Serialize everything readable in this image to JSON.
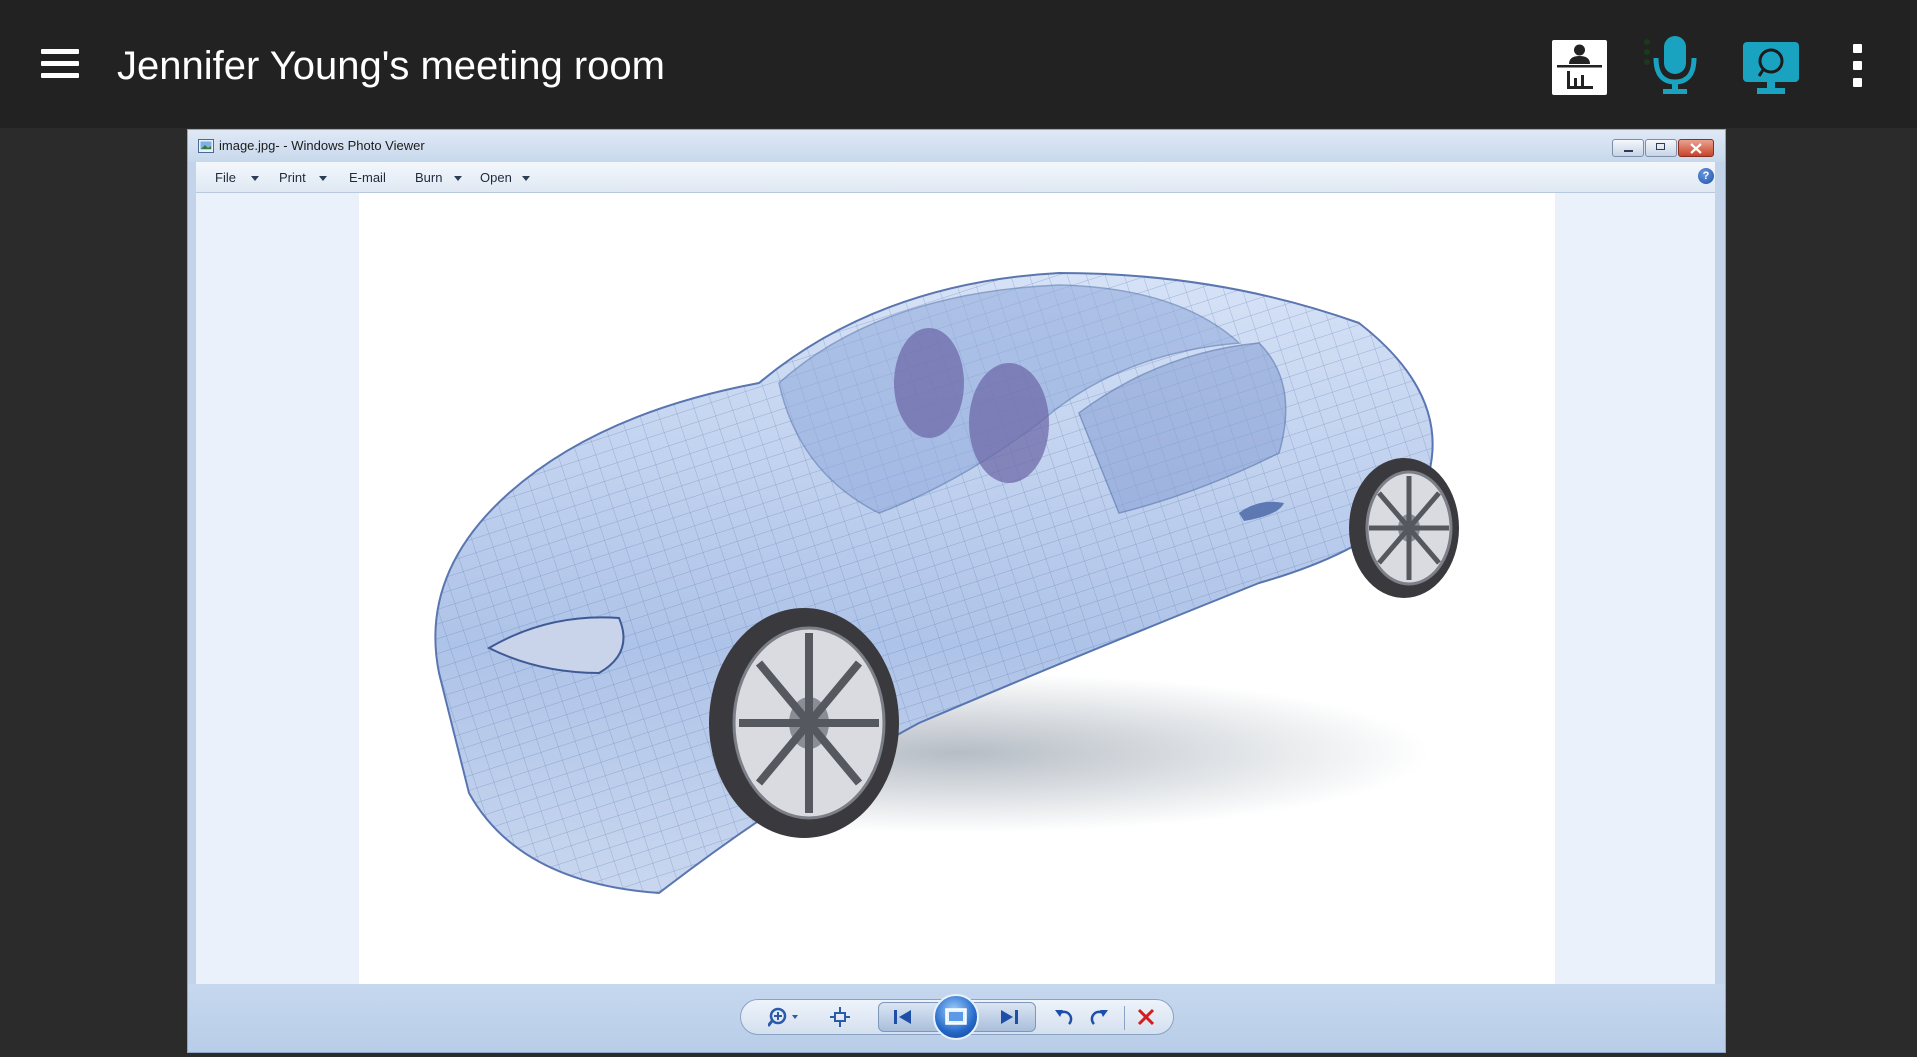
{
  "app": {
    "room_title": "Jennifer Young's meeting room",
    "accent_color": "#1aa3c0",
    "icons": [
      "menu-icon",
      "presenter-icon",
      "microphone-icon",
      "screen-share-icon",
      "more-vert-icon"
    ]
  },
  "viewer": {
    "window_title": "image.jpg- - Windows Photo Viewer",
    "menu": [
      {
        "label": "File",
        "has_dropdown": true
      },
      {
        "label": "Print",
        "has_dropdown": true
      },
      {
        "label": "E-mail",
        "has_dropdown": false
      },
      {
        "label": "Burn",
        "has_dropdown": true
      },
      {
        "label": "Open",
        "has_dropdown": true
      }
    ],
    "help_label": "?",
    "image_subject": "wireframe-car",
    "toolbar_icons": [
      "zoom-icon",
      "actual-size-icon",
      "previous-icon",
      "slideshow-icon",
      "next-icon",
      "rotate-left-icon",
      "rotate-right-icon",
      "delete-icon"
    ]
  }
}
